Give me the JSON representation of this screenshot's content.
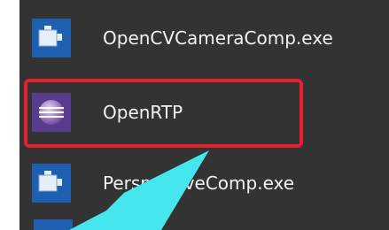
{
  "items": [
    {
      "label": "OpenCVCameraComp.exe",
      "icon": "exe-app-icon"
    },
    {
      "label": "OpenRTP",
      "icon": "openrtp-icon"
    },
    {
      "label": "PerspectiveComp.exe",
      "icon": "exe-app-icon"
    }
  ],
  "colors": {
    "panel_bg": "#333333",
    "text": "#f2f2f2",
    "highlight_border": "#e8202c",
    "arrow_fill": "#45e6ee",
    "exe_tile": "#1f5fb0",
    "rtp_tile": "#5a3c8e"
  }
}
